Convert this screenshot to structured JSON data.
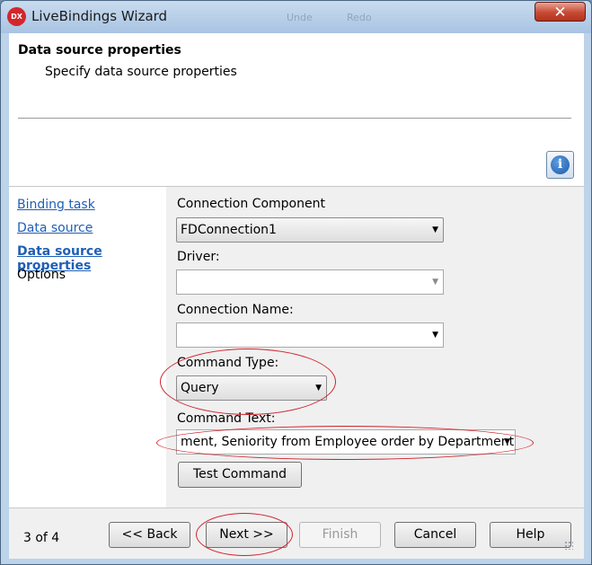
{
  "window": {
    "title": "LiveBindings Wizard",
    "app_logo": "DX",
    "close_label": "✕",
    "background_hints": [
      "Unde",
      "Redo"
    ]
  },
  "header": {
    "title": "Data source properties",
    "subtitle": "Specify data source properties",
    "info_icon": "info-icon"
  },
  "nav": {
    "items": [
      {
        "label": "Binding task",
        "state": "link"
      },
      {
        "label": "Data source",
        "state": "link"
      },
      {
        "label": "Data source properties",
        "state": "active"
      },
      {
        "label": "Options",
        "state": "plain"
      }
    ]
  },
  "form": {
    "connection_component": {
      "label": "Connection Component",
      "value": "FDConnection1"
    },
    "driver": {
      "label": "Driver:",
      "value": ""
    },
    "connection_name": {
      "label": "Connection Name:",
      "value": ""
    },
    "command_type": {
      "label": "Command Type:",
      "value": "Query"
    },
    "command_text": {
      "label": "Command Text:",
      "value": "ment, Seniority from Employee order by Department"
    },
    "test_command_label": "Test Command"
  },
  "footer": {
    "step": "3 of 4",
    "back_label": "<< Back",
    "next_label": "Next >>",
    "finish_label": "Finish",
    "cancel_label": "Cancel",
    "help_label": "Help"
  },
  "colors": {
    "annotation": "#d0222c",
    "link": "#1f5fb4"
  }
}
